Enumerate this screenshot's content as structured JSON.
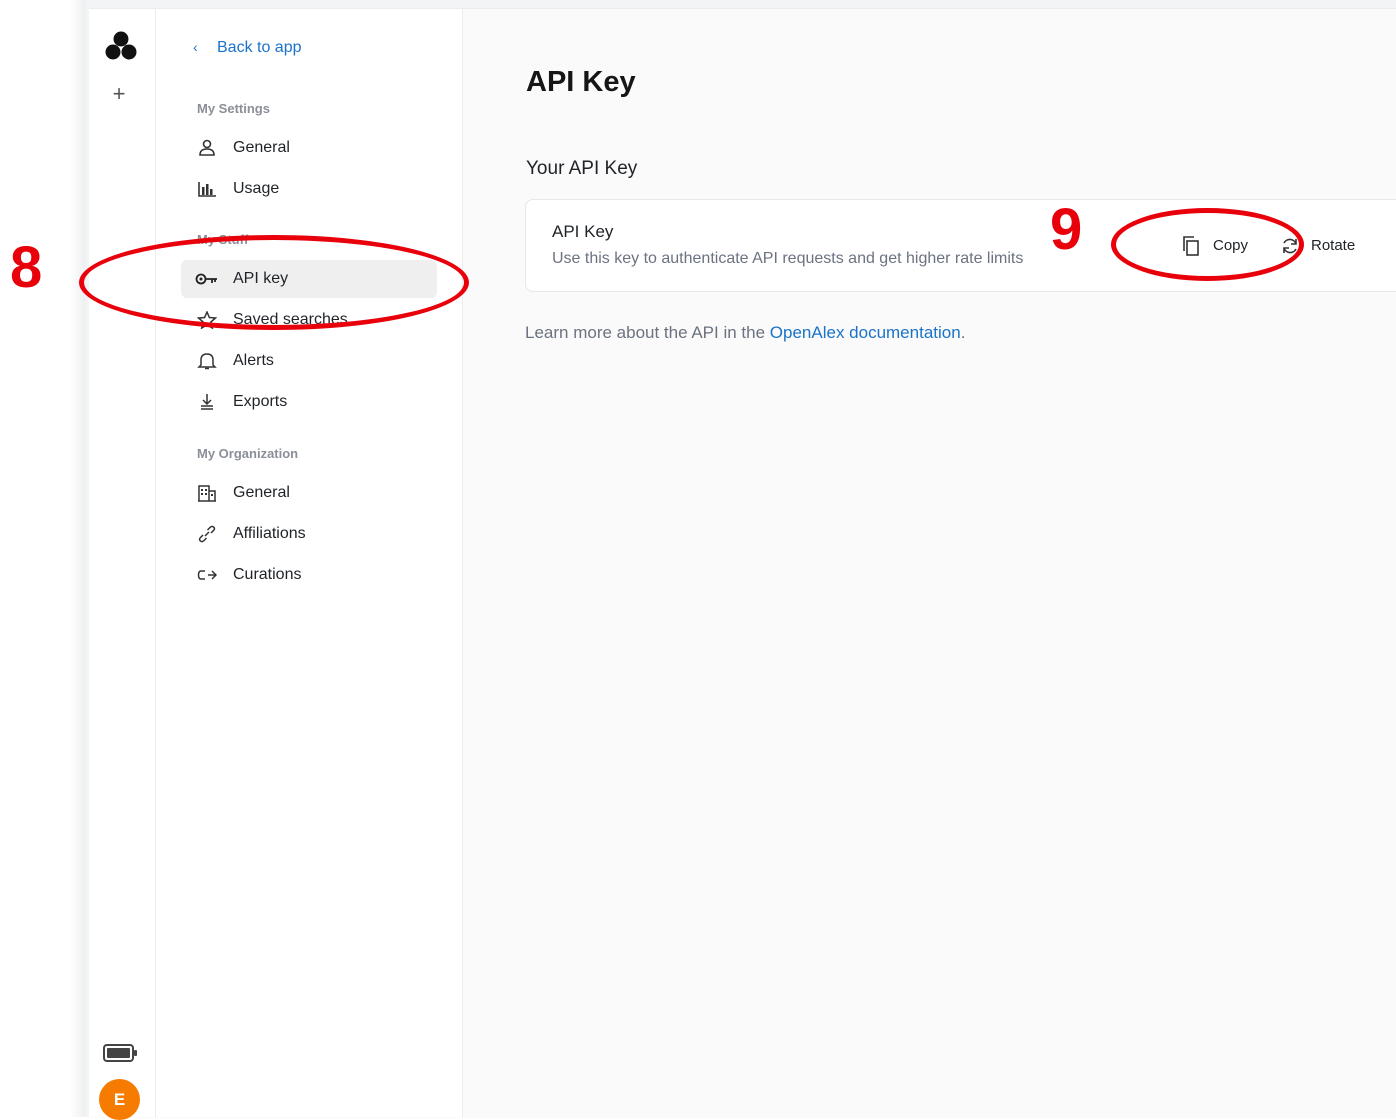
{
  "sidebar_rail": {
    "logo_icon": "openalex-logo-icon",
    "new_icon": "plus-icon",
    "battery_icon": "battery-icon",
    "avatar_initial": "E",
    "avatar_color": "#f57c00"
  },
  "nav": {
    "back_label": "Back to app",
    "sections": [
      {
        "heading": "My Settings",
        "items": [
          {
            "label": "General",
            "icon": "user-icon"
          },
          {
            "label": "Usage",
            "icon": "bar-chart-icon"
          }
        ]
      },
      {
        "heading": "My Stuff",
        "items": [
          {
            "label": "API key",
            "icon": "key-icon",
            "active": true
          },
          {
            "label": "Saved searches",
            "icon": "star-icon"
          },
          {
            "label": "Alerts",
            "icon": "bell-icon"
          },
          {
            "label": "Exports",
            "icon": "download-icon"
          }
        ]
      },
      {
        "heading": "My Organization",
        "items": [
          {
            "label": "General",
            "icon": "building-icon"
          },
          {
            "label": "Affiliations",
            "icon": "link-icon"
          },
          {
            "label": "Curations",
            "icon": "curations-icon"
          }
        ]
      }
    ]
  },
  "main": {
    "title": "API Key",
    "card_heading": "Your API Key",
    "key_card": {
      "title": "API Key",
      "description": "Use this key to authenticate API requests and get higher rate limits",
      "copy_label": "Copy",
      "rotate_label": "Rotate"
    },
    "learn_more_prefix": "Learn more about the API in the ",
    "learn_more_link": "OpenAlex documentation",
    "learn_more_suffix": "."
  },
  "annotations": {
    "marker_8": "8",
    "marker_9": "9",
    "color": "#e8000b"
  },
  "colors": {
    "accent": "#1a73c8",
    "active_bg": "#efefef"
  }
}
